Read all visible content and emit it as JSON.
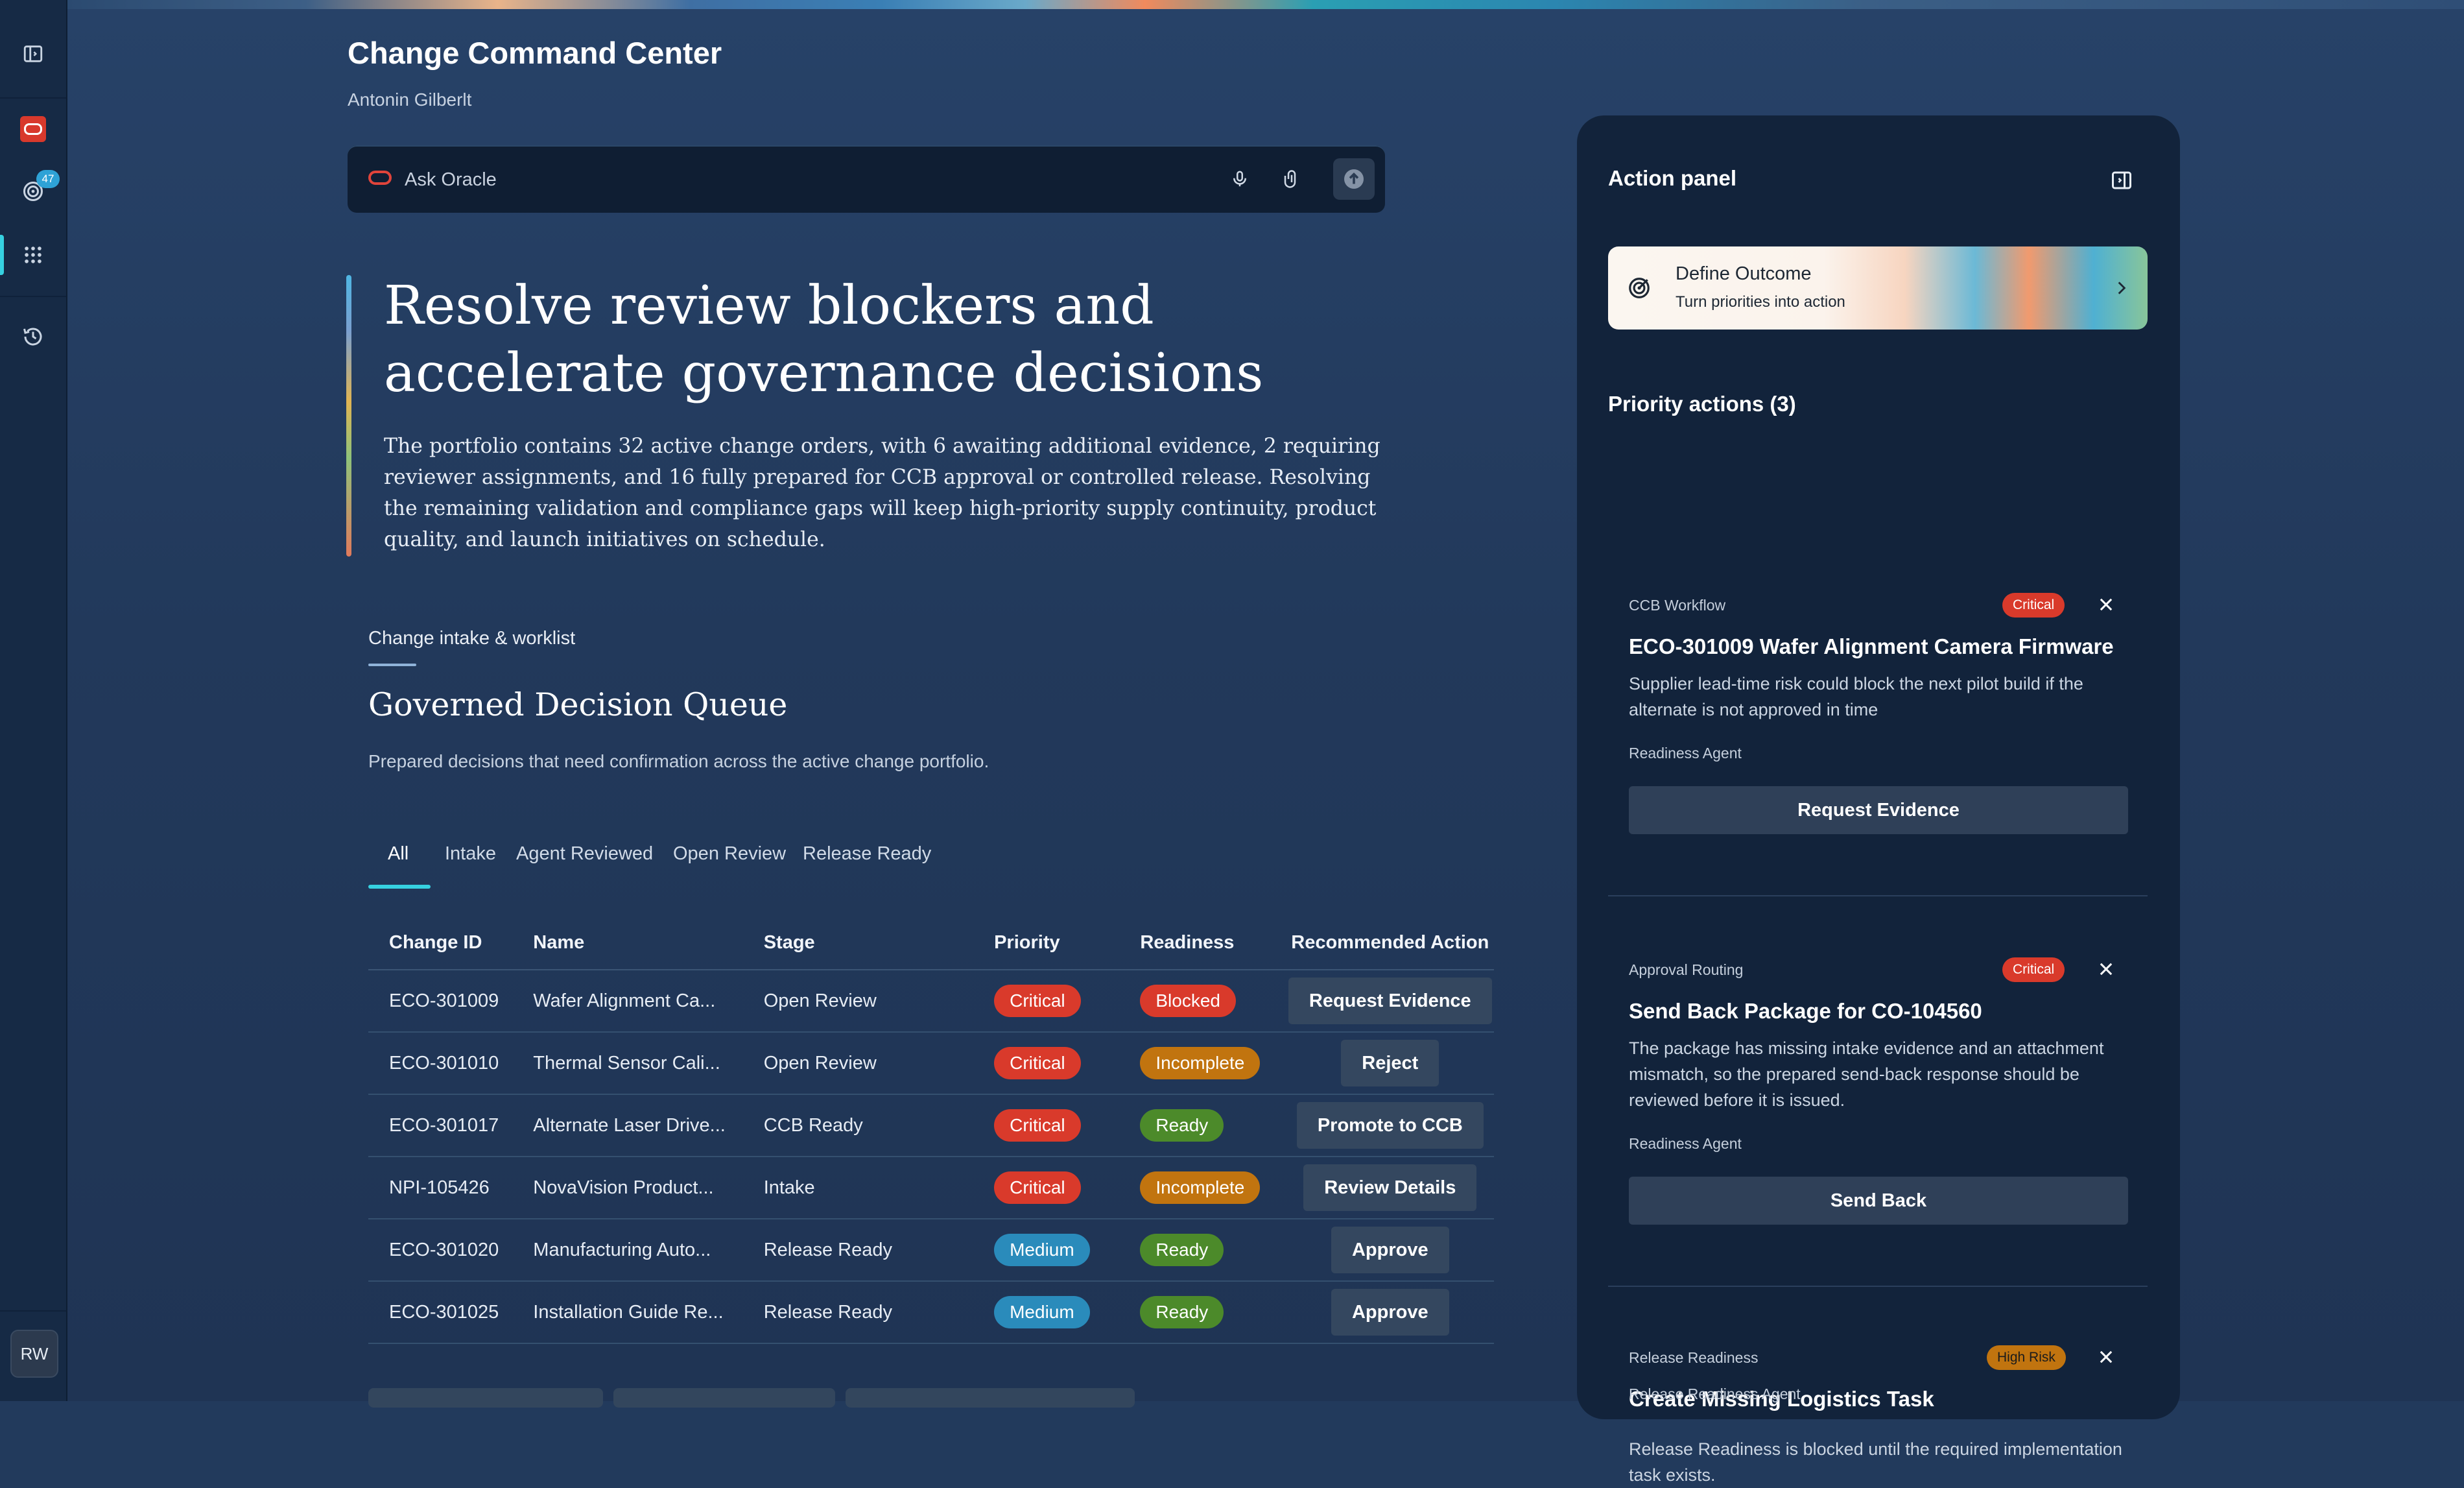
{
  "app": {
    "title": "Change Command Center",
    "user": "Antonin Gilberlt"
  },
  "rail": {
    "notification_count": "47",
    "avatar_initials": "RW"
  },
  "ask": {
    "placeholder": "Ask Oracle"
  },
  "hero": {
    "headline": "Resolve review blockers and accelerate governance decisions",
    "summary": "The portfolio contains 32 active change orders, with 6 awaiting additional evidence, 2 requiring reviewer assignments, and 16 fully prepared for CCB approval or controlled release. Resolving the remaining validation and compliance gaps will keep high-priority supply continuity, product quality, and launch initiatives on schedule."
  },
  "queue": {
    "section_label": "Change intake & worklist",
    "title": "Governed Decision Queue",
    "subtitle": "Prepared decisions that need confirmation across the active change portfolio.",
    "tabs": [
      "All",
      "Intake",
      "Agent Reviewed",
      "Open Review",
      "Release Ready"
    ],
    "active_tab": "All",
    "columns": [
      "Change ID",
      "Name",
      "Stage",
      "Priority",
      "Readiness",
      "Recommended Action"
    ],
    "rows": [
      {
        "id": "ECO-301009",
        "name": "Wafer Alignment Ca...",
        "stage": "Open Review",
        "priority": "Critical",
        "readiness": "Blocked",
        "action": "Request Evidence"
      },
      {
        "id": "ECO-301010",
        "name": "Thermal Sensor Cali...",
        "stage": "Open Review",
        "priority": "Critical",
        "readiness": "Incomplete",
        "action": "Reject"
      },
      {
        "id": "ECO-301017",
        "name": "Alternate Laser Drive...",
        "stage": "CCB Ready",
        "priority": "Critical",
        "readiness": "Ready",
        "action": "Promote to CCB"
      },
      {
        "id": "NPI-105426",
        "name": "NovaVision Product...",
        "stage": "Intake",
        "priority": "Critical",
        "readiness": "Incomplete",
        "action": "Review Details"
      },
      {
        "id": "ECO-301020",
        "name": "Manufacturing Auto...",
        "stage": "Release Ready",
        "priority": "Medium",
        "readiness": "Ready",
        "action": "Approve"
      },
      {
        "id": "ECO-301025",
        "name": "Installation Guide Re...",
        "stage": "Release Ready",
        "priority": "Medium",
        "readiness": "Ready",
        "action": "Approve"
      }
    ]
  },
  "panel": {
    "title": "Action panel",
    "outcome": {
      "title": "Define Outcome",
      "subtitle": "Turn priorities into action"
    },
    "priority_title": "Priority actions (3)",
    "cards": [
      {
        "category": "CCB Workflow",
        "badge": "Critical",
        "title": "ECO-301009 Wafer Alignment Camera Firmware",
        "description": "Supplier lead-time risk could block the next pilot build if the alternate is not approved in time",
        "agent": "Readiness Agent",
        "button": "Request Evidence"
      },
      {
        "category": "Approval Routing",
        "badge": "Critical",
        "title": "Send Back Package for CO-104560",
        "description": "The package has missing intake evidence and an attachment mismatch, so the prepared send-back response should be reviewed before it is issued.",
        "agent": "Readiness Agent",
        "button": "Send Back"
      },
      {
        "category": "Release Readiness",
        "badge": "High Risk",
        "title": "Create Missing Logistics Task",
        "description": "Release Readiness is blocked until the required implementation task exists.",
        "agent": "Release Readiness Agent"
      }
    ]
  },
  "colors": {
    "accent": "#36d1e0",
    "critical": "#d93a2b",
    "medium": "#2a8bbb",
    "incomplete": "#c1740f",
    "ready": "#4c8a2a",
    "id_link": "#e8c472"
  }
}
